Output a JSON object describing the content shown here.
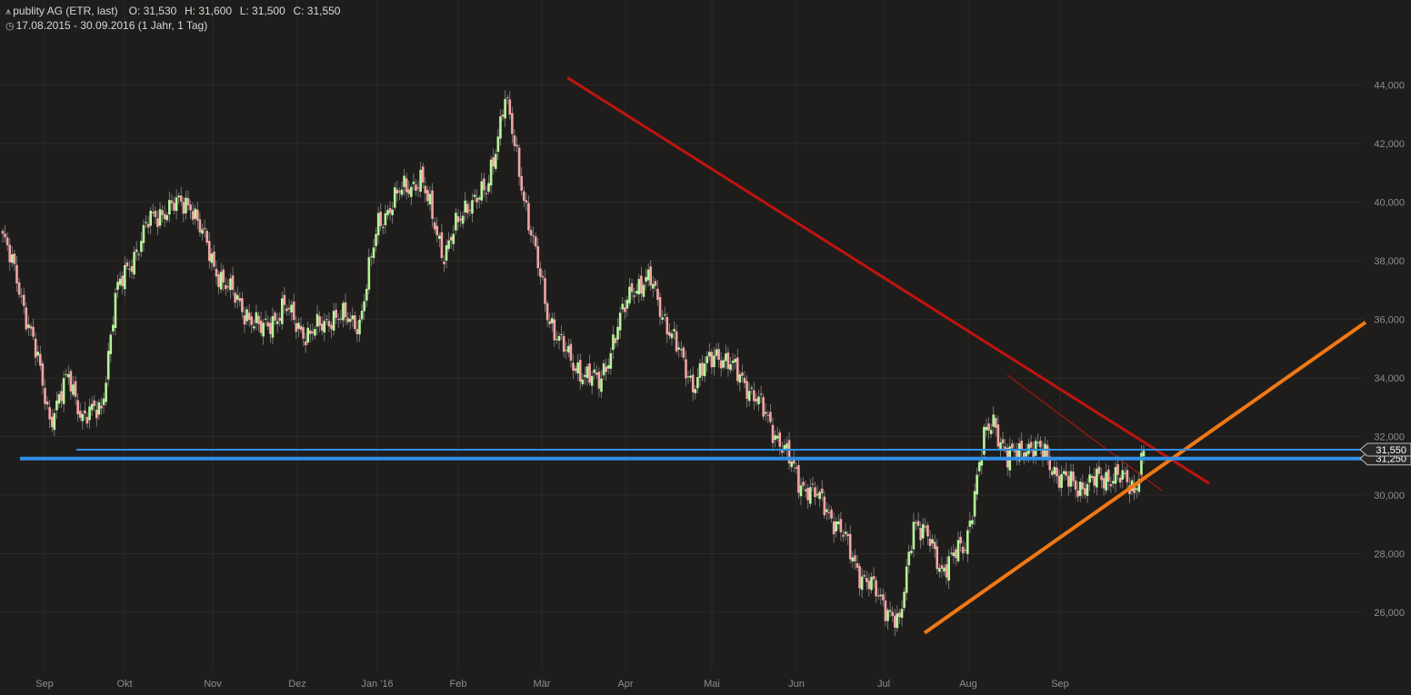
{
  "header": {
    "logo_icon": "chart-logo-icon",
    "title": "publity AG (ETR, last)",
    "open": "O: 31,530",
    "high": "H: 31,600",
    "low": "L: 31,500",
    "close": "C: 31,550",
    "clock_icon": "clock-icon",
    "range": "17.08.2015 - 30.09.2016 (1 Jahr, 1 Tag)"
  },
  "colors": {
    "background": "#1f1d1b",
    "grid": "#2b2927",
    "up_candle": "#b6f59a",
    "down_candle": "#f2a5a5",
    "trendline_red": "#c0140f",
    "trendline_orange": "#f07814",
    "support_blue": "#2f8fe6",
    "axis_text": "#8d8d8d"
  },
  "chart_data": {
    "type": "candlestick",
    "yticks": [
      26000,
      28000,
      30000,
      32000,
      34000,
      36000,
      38000,
      40000,
      42000,
      44000
    ],
    "ytick_labels": [
      "26,000",
      "28,000",
      "30,000",
      "32,000",
      "34,000",
      "36,000",
      "38,000",
      "40,000",
      "42,000",
      "44,000"
    ],
    "ylim": [
      24500,
      44700
    ],
    "xticks": [
      "Sep",
      "Okt",
      "Nov",
      "Dez",
      "Jan '16",
      "Feb",
      "Mär",
      "Apr",
      "Mai",
      "Jun",
      "Jul",
      "Aug",
      "Sep"
    ],
    "last_price_label": "31,550",
    "support_label": "31,250",
    "grid": true,
    "candles_note_anchor_prices": [
      [
        0,
        38800
      ],
      [
        6,
        37400
      ],
      [
        14,
        34900
      ],
      [
        20,
        32600
      ],
      [
        28,
        34000
      ],
      [
        34,
        32700
      ],
      [
        42,
        32900
      ],
      [
        48,
        36800
      ],
      [
        56,
        38200
      ],
      [
        62,
        39300
      ],
      [
        70,
        39800
      ],
      [
        80,
        40000
      ],
      [
        90,
        37800
      ],
      [
        100,
        36600
      ],
      [
        110,
        35600
      ],
      [
        120,
        36400
      ],
      [
        130,
        35400
      ],
      [
        140,
        36100
      ],
      [
        152,
        35900
      ],
      [
        160,
        39300
      ],
      [
        170,
        40400
      ],
      [
        178,
        40800
      ],
      [
        188,
        38200
      ],
      [
        198,
        40000
      ],
      [
        206,
        40300
      ],
      [
        214,
        43600
      ],
      [
        224,
        39400
      ],
      [
        232,
        36200
      ],
      [
        242,
        34500
      ],
      [
        254,
        33800
      ],
      [
        262,
        35700
      ],
      [
        268,
        37100
      ],
      [
        276,
        37300
      ],
      [
        284,
        35600
      ],
      [
        294,
        33800
      ],
      [
        304,
        34900
      ],
      [
        316,
        33900
      ],
      [
        326,
        32600
      ],
      [
        340,
        30400
      ],
      [
        350,
        29700
      ],
      [
        358,
        28600
      ],
      [
        366,
        27200
      ],
      [
        374,
        26500
      ],
      [
        382,
        25500
      ],
      [
        388,
        29200
      ],
      [
        394,
        28500
      ],
      [
        400,
        27500
      ],
      [
        410,
        28300
      ],
      [
        418,
        31900
      ],
      [
        422,
        32600
      ],
      [
        428,
        31200
      ],
      [
        436,
        31700
      ],
      [
        444,
        31400
      ],
      [
        450,
        30600
      ],
      [
        458,
        30300
      ],
      [
        466,
        30500
      ],
      [
        474,
        30700
      ],
      [
        482,
        30200
      ],
      [
        486,
        31550
      ]
    ]
  }
}
